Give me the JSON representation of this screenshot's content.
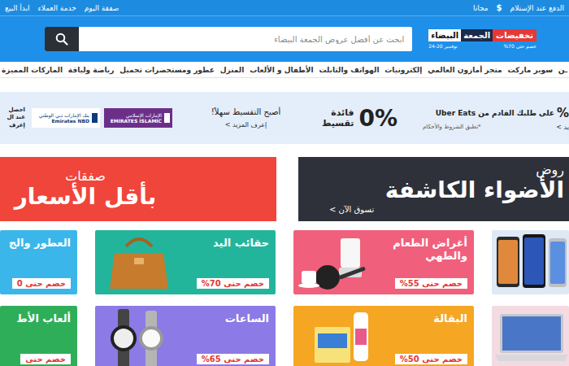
{
  "topbar": {
    "delivery": {
      "label": "الدفع عند الإستلام",
      "icon": "$"
    },
    "shipping": "مجانا",
    "links": [
      "صفقة اليوم",
      "خدمة العملاء",
      "ابدأ البيع"
    ]
  },
  "logo": {
    "badge": "تخفيضات",
    "word1": "الجمعة",
    "word2": "البيضاء",
    "discount": "خصم حتى 70%",
    "dates": "نوفمبر 20-24"
  },
  "search": {
    "placeholder": "ابحث عن أفضل عروض الجمعة البيضاء"
  },
  "nav": [
    "ـن",
    "سوبر ماركت",
    "متجر أمازون العالمي",
    "إلكترونيات",
    "الهواتف والتابلت",
    "الأطفال و الألعاب",
    "المنزل",
    "عطور ومستحضرات تجميل",
    "رياضة ولياقة",
    "الماركات المميزة"
  ],
  "strip": {
    "uber": {
      "percent": "%",
      "text": "على طلبك القادم من Uber Eats",
      "more": "يد >",
      "terms": "*تطبق الشروط والأحكام"
    },
    "installment": {
      "rate": "0%",
      "line1": "فائدة",
      "line2": "تقسيط",
      "title": "أصبح التقسيط سهلاً!",
      "more": "إعرف المزيد >"
    },
    "banks": [
      {
        "kind": "filled",
        "arabic": "الإمارات الإسلامي",
        "english": "EMIRATES ISLAMIC",
        "color": "#6b2f8a"
      },
      {
        "kind": "plain",
        "arabic": "بنك الإمارات دبي الوطني",
        "english": "Emirates NBD",
        "color": "#0b3b7c"
      }
    ],
    "edge": [
      "احصل",
      "عند ال",
      "إعرف"
    ]
  },
  "banners": [
    {
      "kind": "spotlight",
      "kicker": "روض",
      "title": "الأضواء الكاشفة",
      "link": "تسوق الآن >",
      "color": "#2e3139"
    },
    {
      "kind": "deals",
      "kicker": "صفقات",
      "title": "بأقل الأسعار",
      "color": "#f0453a"
    }
  ],
  "cards": [
    {
      "kind": "phones",
      "color": "#dfe9f5"
    },
    {
      "kind": "kitchen",
      "title": "أغراض الطعام والطهي",
      "discount": "خصم حتى 55%",
      "color": "#f0607c"
    },
    {
      "kind": "bag",
      "title": "حقائب اليد",
      "discount": "خصم حتى 70%",
      "color": "#22b59c"
    },
    {
      "kind": "perfume",
      "title": "العطور والج",
      "discount": "خصم حتى 0",
      "color": "#3bb6ea"
    },
    {
      "kind": "laptop",
      "color": "#f4dbe2"
    },
    {
      "kind": "grocery",
      "title": "البقالة",
      "discount": "خصم حتى 50%",
      "color": "#f5a623"
    },
    {
      "kind": "watches",
      "title": "الساعات",
      "discount": "خصم حتى 65%",
      "color": "#8c7ae6"
    },
    {
      "kind": "toys",
      "title": "ألعاب الأط",
      "discount": "خصم حتى",
      "color": "#2fae5a"
    }
  ]
}
